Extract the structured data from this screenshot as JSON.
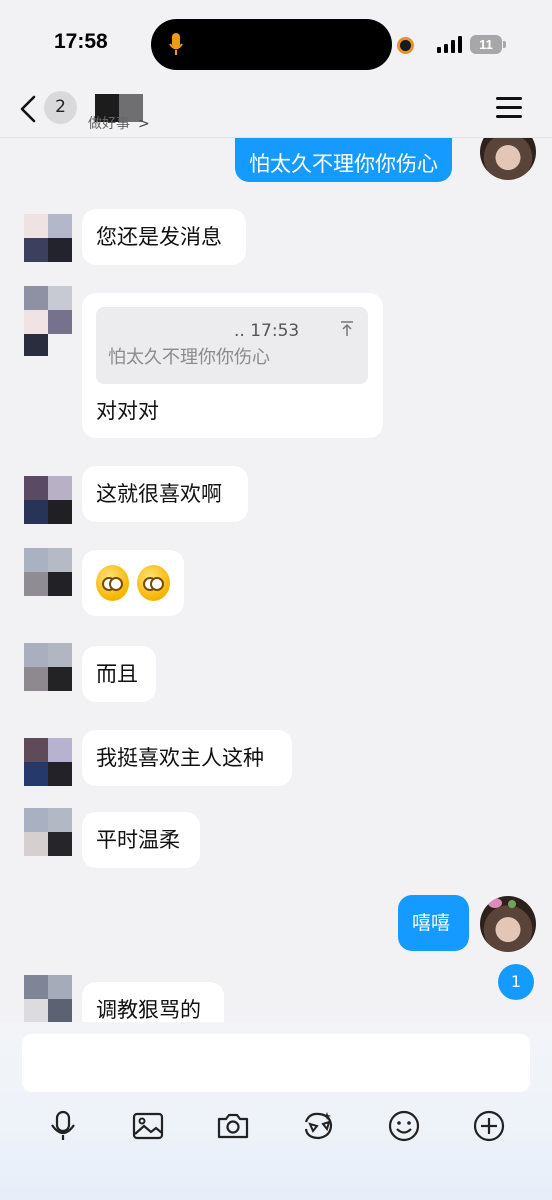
{
  "status_bar": {
    "time": "17:58",
    "battery": "11"
  },
  "header": {
    "unread_count": "2",
    "subtitle": "做好事"
  },
  "messages": {
    "top_sent": "怕太久不理你你伤心",
    "m1": "您还是发消息",
    "quote": {
      "time": ".. 17:53",
      "text": "怕太久不理你你伤心"
    },
    "m2": "对对对",
    "m3": "这就很喜欢啊",
    "m4_emoji": [
      "heart-eyes-emoji",
      "heart-eyes-emoji"
    ],
    "m5": "而且",
    "m6": "我挺喜欢主人这种",
    "m7": "平时温柔",
    "sent2": "嘻嘻",
    "m8": "调教狠骂的"
  },
  "new_message_badge": "1",
  "toolbar_icons": [
    "microphone-icon",
    "image-icon",
    "camera-icon",
    "sticker-icon",
    "emoji-icon",
    "plus-icon"
  ],
  "colors": {
    "accent": "#159bff",
    "background": "#f2f2f4",
    "bubble": "#ffffff"
  }
}
